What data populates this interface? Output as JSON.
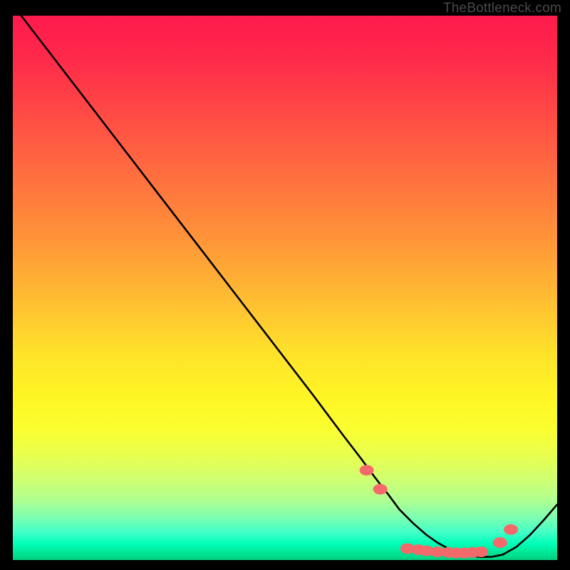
{
  "watermark": "TheBottleneck.com",
  "chart_data": {
    "type": "line",
    "title": "",
    "xlabel": "",
    "ylabel": "",
    "xlim": [
      0,
      100
    ],
    "ylim": [
      0,
      100
    ],
    "grid": false,
    "curve": {
      "name": "bottleneck-curve",
      "x": [
        0,
        5,
        10,
        15,
        20,
        25,
        30,
        35,
        40,
        45,
        50,
        55,
        58,
        61,
        64,
        66.5,
        69,
        71,
        73.5,
        76,
        78,
        80,
        82,
        84,
        86,
        88,
        90,
        92.5,
        95,
        97.5,
        100
      ],
      "y": [
        102,
        95.5,
        89,
        82.5,
        76,
        69.5,
        63,
        56.5,
        50,
        43.5,
        37,
        30.5,
        26.5,
        22.5,
        18.6,
        15.2,
        12,
        9.3,
        6.8,
        4.6,
        3.2,
        2.1,
        1.3,
        0.8,
        0.55,
        0.6,
        1.0,
        2.4,
        4.6,
        7.3,
        10.2
      ]
    },
    "dots": {
      "name": "highlight-points",
      "color": "#f46a6a",
      "points": [
        {
          "x": 65.0,
          "y": 16.5
        },
        {
          "x": 67.5,
          "y": 13.0
        },
        {
          "x": 72.5,
          "y": 2.1
        },
        {
          "x": 74.5,
          "y": 1.9
        },
        {
          "x": 76.0,
          "y": 1.7
        },
        {
          "x": 78.0,
          "y": 1.5
        },
        {
          "x": 80.0,
          "y": 1.4
        },
        {
          "x": 81.5,
          "y": 1.3
        },
        {
          "x": 83.0,
          "y": 1.3
        },
        {
          "x": 84.5,
          "y": 1.4
        },
        {
          "x": 86.0,
          "y": 1.5
        },
        {
          "x": 89.5,
          "y": 3.2
        },
        {
          "x": 91.5,
          "y": 5.6
        }
      ]
    },
    "gradient_description": "vertical rainbow red-to-green heatmap background"
  }
}
